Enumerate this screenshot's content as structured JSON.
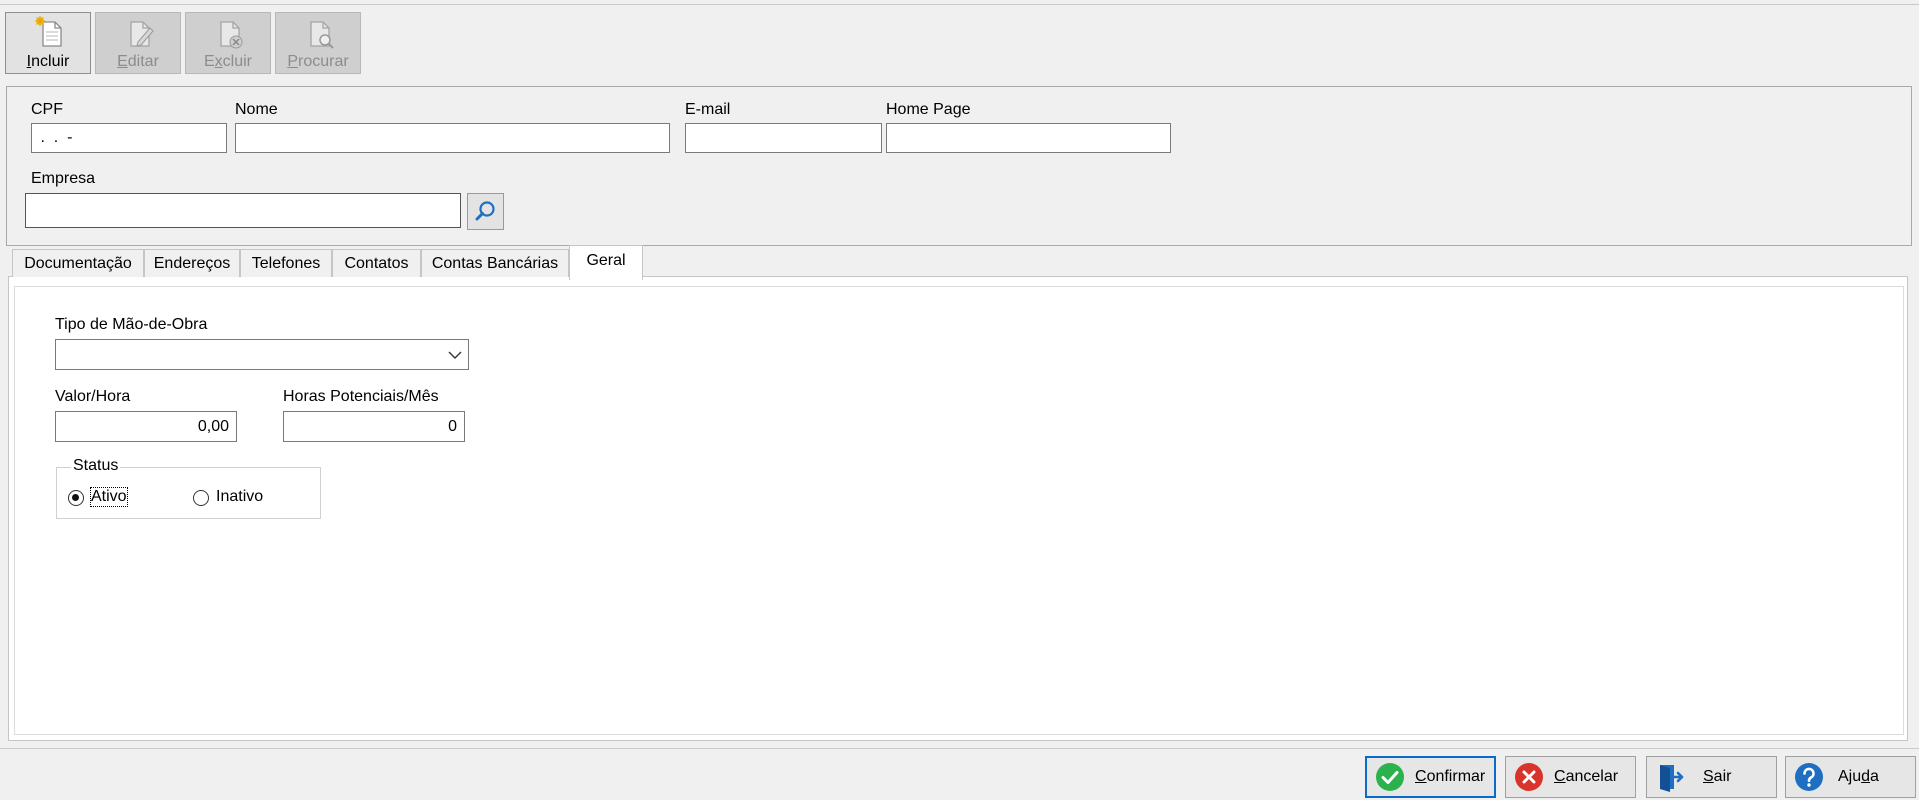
{
  "toolbar": {
    "incluir": {
      "pre": "",
      "u": "I",
      "post": "ncluir"
    },
    "editar": {
      "pre": "",
      "u": "E",
      "post": "ditar"
    },
    "excluir": {
      "pre": "E",
      "u": "x",
      "post": "cluir"
    },
    "procurar": {
      "pre": "",
      "u": "P",
      "post": "rocurar"
    }
  },
  "header": {
    "cpf_label": "CPF",
    "cpf_value": " .  .  -",
    "nome_label": "Nome",
    "nome_value": "",
    "email_label": "E-mail",
    "email_value": "",
    "homepage_label": "Home Page",
    "homepage_value": "",
    "empresa_label": "Empresa",
    "empresa_value": ""
  },
  "tabs": [
    {
      "label": "Documentação"
    },
    {
      "label": "Endereços"
    },
    {
      "label": "Telefones"
    },
    {
      "label": "Contatos"
    },
    {
      "label": "Contas Bancárias"
    },
    {
      "label": "Geral",
      "active": true
    }
  ],
  "geral": {
    "tipo_label": "Tipo de Mão-de-Obra",
    "tipo_value": "",
    "valor_label": "Valor/Hora",
    "valor_value": "0,00",
    "horas_label": "Horas Potenciais/Mês",
    "horas_value": "0",
    "status_label": "Status",
    "status_options": [
      {
        "label": "Ativo",
        "selected": true
      },
      {
        "label": "Inativo",
        "selected": false
      }
    ]
  },
  "footer": {
    "confirmar": {
      "pre": "",
      "u": "C",
      "post": "onfirmar"
    },
    "cancelar": {
      "pre": "",
      "u": "C",
      "post": "ancelar"
    },
    "sair": {
      "pre": "",
      "u": "S",
      "post": "air"
    },
    "ajuda": {
      "pre": "Aju",
      "u": "d",
      "post": "a"
    }
  },
  "colors": {
    "confirm_green": "#2bb24c",
    "cancel_red": "#d9342b",
    "icon_blue": "#1e6fc2",
    "focus_border": "#0a6ac8"
  },
  "icons": [
    "new-document-icon",
    "edit-document-icon",
    "delete-document-icon",
    "search-document-icon",
    "magnifier-icon",
    "dropdown-chevron-icon",
    "check-icon",
    "cancel-icon",
    "exit-door-icon",
    "help-icon"
  ]
}
